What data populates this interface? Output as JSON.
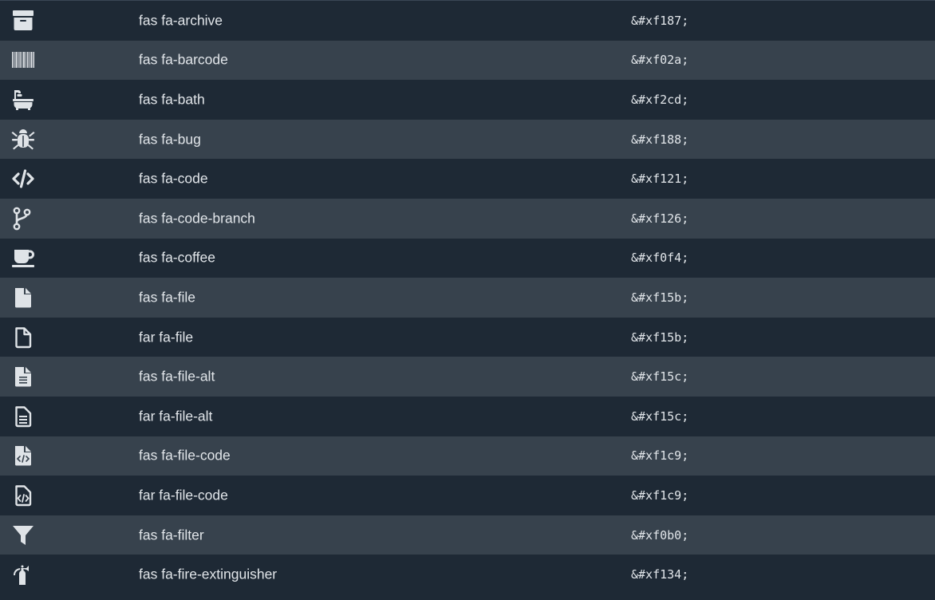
{
  "colors": {
    "row_dark": "#1e2935",
    "row_light": "#37424d",
    "text": "#e2e6ea",
    "icon": "#dfe3e7"
  },
  "rows": [
    {
      "icon": "archive-icon",
      "cls": "fas fa-archive",
      "code": "&#xf187;"
    },
    {
      "icon": "barcode-icon",
      "cls": "fas fa-barcode",
      "code": "&#xf02a;"
    },
    {
      "icon": "bath-icon",
      "cls": "fas fa-bath",
      "code": "&#xf2cd;"
    },
    {
      "icon": "bug-icon",
      "cls": "fas fa-bug",
      "code": "&#xf188;"
    },
    {
      "icon": "code-icon",
      "cls": "fas fa-code",
      "code": "&#xf121;"
    },
    {
      "icon": "code-branch-icon",
      "cls": "fas fa-code-branch",
      "code": "&#xf126;"
    },
    {
      "icon": "coffee-icon",
      "cls": "fas fa-coffee",
      "code": "&#xf0f4;"
    },
    {
      "icon": "file-solid-icon",
      "cls": "fas fa-file",
      "code": "&#xf15b;"
    },
    {
      "icon": "file-regular-icon",
      "cls": "far fa-file",
      "code": "&#xf15b;"
    },
    {
      "icon": "file-alt-solid-icon",
      "cls": "fas fa-file-alt",
      "code": "&#xf15c;"
    },
    {
      "icon": "file-alt-regular-icon",
      "cls": "far fa-file-alt",
      "code": "&#xf15c;"
    },
    {
      "icon": "file-code-solid-icon",
      "cls": "fas fa-file-code",
      "code": "&#xf1c9;"
    },
    {
      "icon": "file-code-regular-icon",
      "cls": "far fa-file-code",
      "code": "&#xf1c9;"
    },
    {
      "icon": "filter-icon",
      "cls": "fas fa-filter",
      "code": "&#xf0b0;"
    },
    {
      "icon": "fire-extinguisher-icon",
      "cls": "fas fa-fire-extinguisher",
      "code": "&#xf134;"
    }
  ]
}
